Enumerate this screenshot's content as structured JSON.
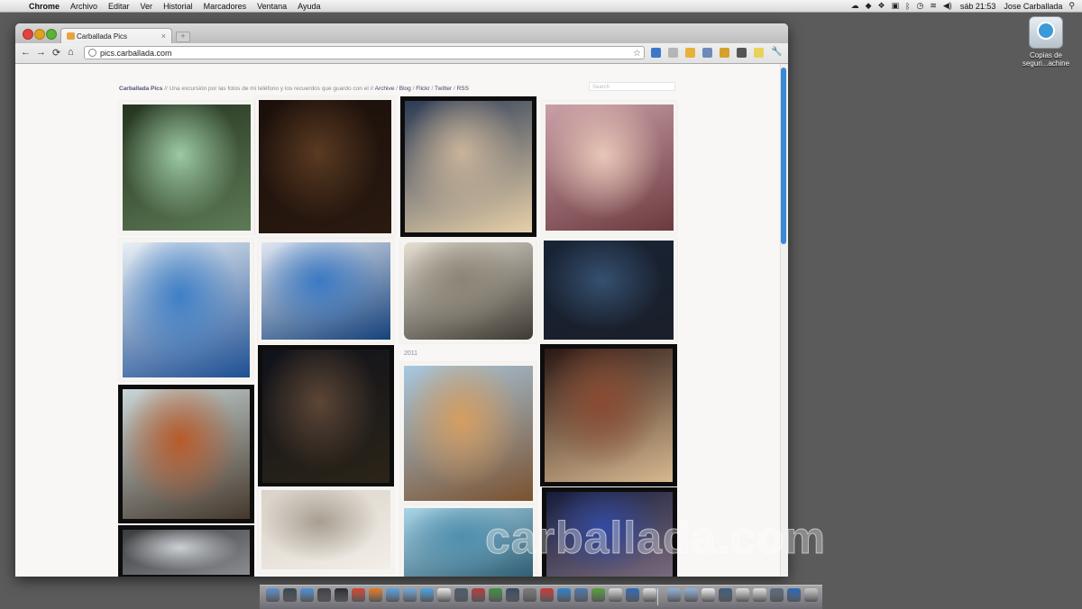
{
  "menubar": {
    "app_name": "Chrome",
    "items": [
      "Archivo",
      "Editar",
      "Ver",
      "Historial",
      "Marcadores",
      "Ventana",
      "Ayuda"
    ],
    "clock": "sáb 21:53",
    "user": "Jose Carballada",
    "status_icons": [
      "cloud-icon",
      "evernote-icon",
      "dropbox-icon",
      "lock-icon",
      "bluetooth-icon",
      "time-machine-icon",
      "wifi-icon",
      "volume-icon",
      "spotlight-icon"
    ]
  },
  "desktop": {
    "icon_label_line1": "Copias de",
    "icon_label_line2": "seguri...achine"
  },
  "browser": {
    "tab_title": "Carballada Pics",
    "tab_close": "×",
    "newtab": "+",
    "url": "pics.carballada.com",
    "nav": {
      "back": "←",
      "forward": "→",
      "reload": "⟳",
      "home": "⌂",
      "star": "☆",
      "wrench": "🔧"
    }
  },
  "site": {
    "name": "Carballada Pics",
    "tagline": " // Una excursión por las fotos de mi teléfono y los recuerdos que guardo con el // ",
    "links": [
      "Archive",
      "Blog",
      "Flickr",
      "Twitter",
      "RSS"
    ],
    "sep": " / ",
    "search_placeholder": "Search",
    "year_label": "2011"
  },
  "photos": [
    {
      "id": "window-view",
      "colors": [
        "#253520",
        "#9cc9a3",
        "#5d7a55"
      ],
      "frame": "white",
      "rounded": false
    },
    {
      "id": "boy-night",
      "colors": [
        "#1a0f0a",
        "#5a3a22",
        "#2a1a10"
      ],
      "frame": "white",
      "rounded": false
    },
    {
      "id": "two-kids",
      "colors": [
        "#2c3b55",
        "#c9b49a",
        "#e7d0a9"
      ],
      "frame": "black",
      "rounded": false
    },
    {
      "id": "carousel-ride",
      "colors": [
        "#caa0a8",
        "#e8c7b8",
        "#6b3a3f"
      ],
      "frame": "white",
      "rounded": false
    },
    {
      "id": "water-ball-1",
      "colors": [
        "#e9eff5",
        "#3e7fc6",
        "#1e4f93"
      ],
      "frame": "white",
      "rounded": false
    },
    {
      "id": "water-ball-2",
      "colors": [
        "#dfe6f2",
        "#3a79c3",
        "#16427a"
      ],
      "frame": "white",
      "rounded": false
    },
    {
      "id": "ghent-canal",
      "colors": [
        "#e5dfd2",
        "#8c8576",
        "#3e3a33"
      ],
      "frame": "white",
      "rounded": true
    },
    {
      "id": "plane-wing",
      "colors": [
        "#182335",
        "#36506f",
        "#1a1f29"
      ],
      "frame": "white",
      "rounded": false
    },
    {
      "id": "castle-tower",
      "colors": [
        "#10121a",
        "#5c4636",
        "#2b2418"
      ],
      "frame": "black",
      "rounded": false
    },
    {
      "id": "building-sky",
      "colors": [
        "#a8c8df",
        "#d59e60",
        "#7a5230"
      ],
      "frame": "white",
      "rounded": false
    },
    {
      "id": "street-people",
      "colors": [
        "#2a1713",
        "#8a4b32",
        "#d7b890"
      ],
      "frame": "black",
      "rounded": false
    },
    {
      "id": "autumn-tree",
      "colors": [
        "#c9d6d6",
        "#b85a2a",
        "#45382c"
      ],
      "frame": "black",
      "rounded": false
    },
    {
      "id": "hotel-room",
      "colors": [
        "#d9d2c8",
        "#a89e91",
        "#f2eee8"
      ],
      "frame": "white",
      "rounded": false
    },
    {
      "id": "city-glass",
      "colors": [
        "#a9d4e6",
        "#4f8fae",
        "#2a5a70"
      ],
      "frame": "white",
      "rounded": false
    },
    {
      "id": "street-sign",
      "colors": [
        "#151c3a",
        "#334aa0",
        "#7d6d7f"
      ],
      "frame": "black",
      "rounded": false
    },
    {
      "id": "white-house",
      "colors": [
        "#3a3b3d",
        "#ccd0d4",
        "#8a8c90"
      ],
      "frame": "black",
      "rounded": false
    }
  ],
  "dock": {
    "apps": [
      {
        "name": "finder-icon",
        "color": "#5d8fc9"
      },
      {
        "name": "lightroom-icon",
        "color": "#35454f"
      },
      {
        "name": "safari-icon",
        "color": "#4a91d9"
      },
      {
        "name": "mail-icon",
        "color": "#3d3f45"
      },
      {
        "name": "dashboard-icon",
        "color": "#262a30"
      },
      {
        "name": "chrome-icon",
        "color": "#d8442f"
      },
      {
        "name": "firefox-icon",
        "color": "#e57b25"
      },
      {
        "name": "itunes-icon",
        "color": "#5aa2e0"
      },
      {
        "name": "globe-icon",
        "color": "#6fa8d8"
      },
      {
        "name": "messages-icon",
        "color": "#4aa3e3"
      },
      {
        "name": "calendar-icon",
        "color": "#e9e9e9"
      },
      {
        "name": "photos-icon",
        "color": "#4c5a6a"
      },
      {
        "name": "tool-icon",
        "color": "#b53a3a"
      },
      {
        "name": "tweetdeck-icon",
        "color": "#3f8f3f"
      },
      {
        "name": "app-store-icon",
        "color": "#364a63"
      },
      {
        "name": "settings-icon",
        "color": "#7a7a7a"
      },
      {
        "name": "preview-icon",
        "color": "#c83a3a"
      },
      {
        "name": "skype-icon",
        "color": "#2f80d0"
      },
      {
        "name": "cloud-app-icon",
        "color": "#4a78b0"
      },
      {
        "name": "evernote-app-icon",
        "color": "#55a036"
      },
      {
        "name": "textedit-icon",
        "color": "#d8d8d8"
      },
      {
        "name": "terminal-icon",
        "color": "#2e6ab8"
      },
      {
        "name": "notes-icon",
        "color": "#e2e2e2"
      },
      {
        "name": "folder-docs-icon",
        "color": "#8fb1d6"
      },
      {
        "name": "folder-downloads-icon",
        "color": "#8fb1d6"
      },
      {
        "name": "document-icon",
        "color": "#eeeeee"
      },
      {
        "name": "window-thumb-1-icon",
        "color": "#3e5c7a"
      },
      {
        "name": "window-thumb-2-icon",
        "color": "#dcdcdc"
      },
      {
        "name": "window-thumb-3-icon",
        "color": "#e2e2e2"
      },
      {
        "name": "window-thumb-4-icon",
        "color": "#5a6b7e"
      },
      {
        "name": "window-thumb-5-icon",
        "color": "#2a69b8"
      },
      {
        "name": "trash-icon",
        "color": "#c8c8c8"
      }
    ]
  },
  "watermark": {
    "text": "carballada.com"
  }
}
